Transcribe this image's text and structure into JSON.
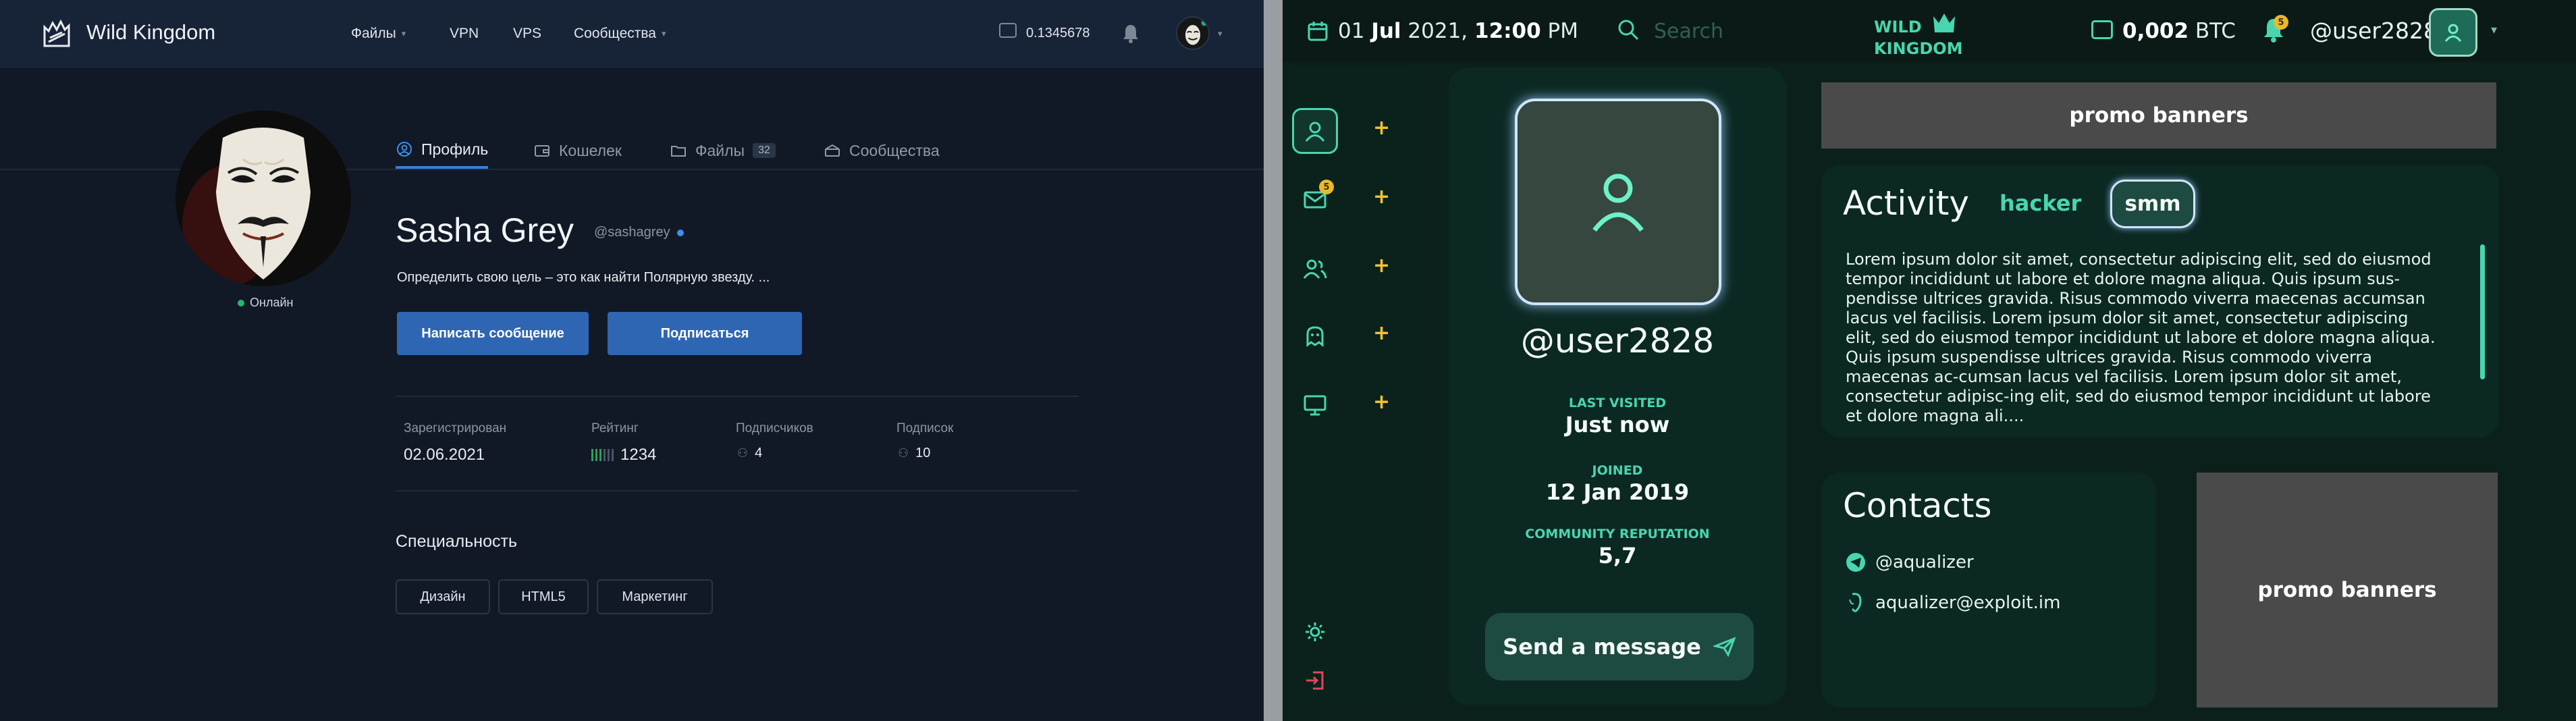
{
  "left": {
    "brand": "Wild Kingdom",
    "nav": [
      {
        "label": "Файлы",
        "caret": true
      },
      {
        "label": "VPN",
        "caret": false
      },
      {
        "label": "VPS",
        "caret": false
      },
      {
        "label": "Сообщества",
        "caret": true
      }
    ],
    "balance": "0.1345678",
    "status": "Онлайн",
    "tabs": [
      {
        "label": "Профиль",
        "icon": "user-icon",
        "active": true
      },
      {
        "label": "Кошелек",
        "icon": "wallet-icon"
      },
      {
        "label": "Файлы",
        "icon": "folder-icon",
        "badge": "32"
      },
      {
        "label": "Сообщества",
        "icon": "community-icon"
      }
    ],
    "name": "Sasha Grey",
    "handle": "@sashagrey",
    "bio": "Определить свою цель – это как найти Полярную звезду. ...",
    "buttons": {
      "message": "Написать сообщение",
      "subscribe": "Подписаться"
    },
    "stats": {
      "registered_label": "Зарегистрирован",
      "registered_value": "02.06.2021",
      "rating_label": "Рейтинг",
      "rating_value": "1234",
      "followers_label": "Подписчиков",
      "followers_value": "4",
      "subs_label": "Подписок",
      "subs_value": "10"
    },
    "specialty_title": "Специальность",
    "chips": [
      "Дизайн",
      "HTML5",
      "Маркетинг"
    ]
  },
  "right": {
    "date_prefix": "01 ",
    "date_month": "Jul",
    "date_year": " 2021, ",
    "date_time": "12:00",
    "date_ampm": " PM",
    "search_placeholder": "Search",
    "logo_line1": "WILD",
    "logo_line2": "KINGDOM",
    "btc_value": "0,002",
    "btc_unit": " BTC",
    "notif_count": "5",
    "username": "@user2828",
    "sidebar_mail_count": "5",
    "plus": "+",
    "card_username": "@user2828",
    "last_visited_label": "LAST VISITED",
    "last_visited_value": "Just now",
    "joined_label": "JOINED",
    "joined_value": "12 Jan 2019",
    "reputation_label": "COMMUNITY REPUTATION",
    "reputation_value": "5,7",
    "send_label": "Send a message",
    "promo": "promo banners",
    "activity_title": "Activity",
    "tags": [
      "hacker",
      "smm"
    ],
    "activity_text": "Lorem ipsum dolor sit amet, consectetur adipiscing elit, sed do eiusmod tempor incididunt ut labore et dolore magna aliqua. Quis ipsum sus-pendisse ultrices gravida. Risus commodo viverra maecenas accumsan lacus vel facilisis. Lorem ipsum dolor sit amet, consectetur adipiscing elit, sed do eiusmod tempor incididunt ut labore et dolore magna aliqua. Quis ipsum suspendisse ultrices gravida. Risus commodo viverra maecenas ac-cumsan lacus vel facilisis. Lorem ipsum dolor sit amet, consectetur adipisc-ing elit, sed do eiusmod tempor incididunt ut labore et dolore magna ali....",
    "contacts_title": "Contacts",
    "contact_telegram": "@aqualizer",
    "contact_jabber": "aqualizer@exploit.im"
  },
  "colors": {
    "left_bg": "#121926",
    "left_accent": "#2f66b4",
    "right_bg": "#0c201b",
    "right_accent": "#47d6b0",
    "badge_yellow": "#e8b92e"
  }
}
